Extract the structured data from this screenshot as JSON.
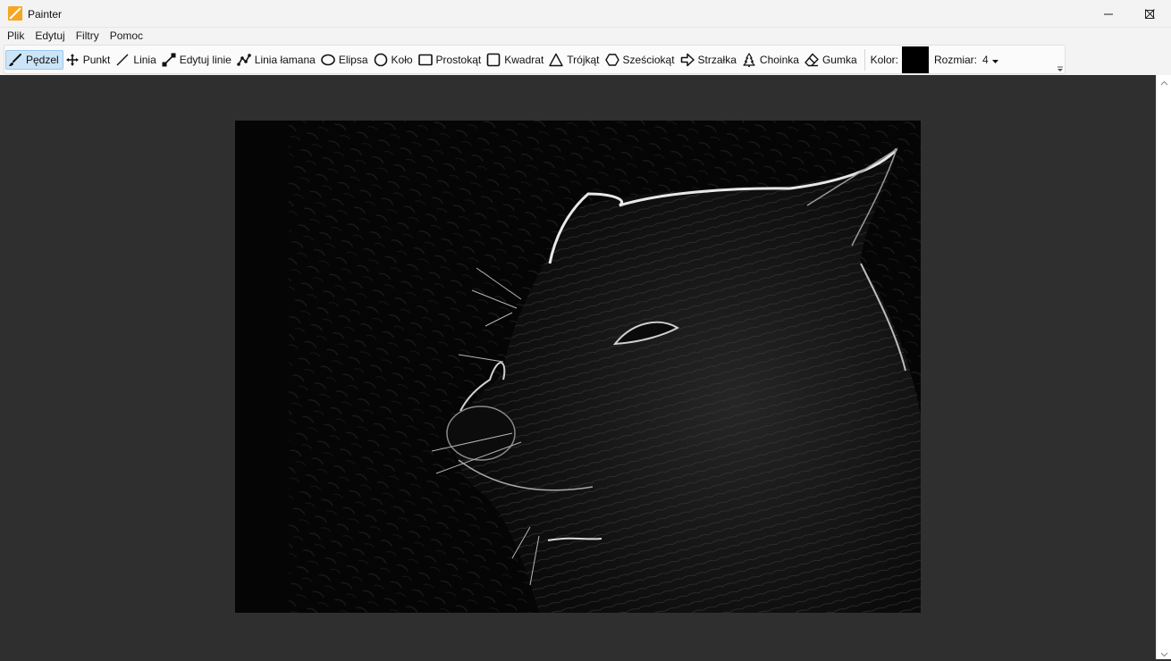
{
  "window": {
    "title": "Painter",
    "controls": {
      "minimize": "minimize",
      "maximize": "maximize",
      "close": "close"
    }
  },
  "menu": [
    "Plik",
    "Edytuj",
    "Filtry",
    "Pomoc"
  ],
  "toolbar": {
    "tools": [
      {
        "label": "Pędzel",
        "icon": "brush-icon",
        "active": true
      },
      {
        "label": "Punkt",
        "icon": "move-point-icon"
      },
      {
        "label": "Linia",
        "icon": "line-icon"
      },
      {
        "label": "Edytuj linie",
        "icon": "edit-line-icon"
      },
      {
        "label": "Linia łamana",
        "icon": "polyline-icon"
      },
      {
        "label": "Elipsa",
        "icon": "ellipse-icon"
      },
      {
        "label": "Koło",
        "icon": "circle-icon"
      },
      {
        "label": "Prostokąt",
        "icon": "rectangle-icon"
      },
      {
        "label": "Kwadrat",
        "icon": "square-icon"
      },
      {
        "label": "Trójkąt",
        "icon": "triangle-icon"
      },
      {
        "label": "Sześciokąt",
        "icon": "hexagon-icon"
      },
      {
        "label": "Strzałka",
        "icon": "arrow-icon"
      },
      {
        "label": "Choinka",
        "icon": "tree-icon"
      },
      {
        "label": "Gumka",
        "icon": "eraser-icon"
      }
    ],
    "color_label": "Kolor:",
    "color_value": "#000000",
    "size_label": "Rozmiar:",
    "size_value": "4"
  },
  "colors": {
    "workspace": "#2f2f2f",
    "chrome": "#f3f3f3",
    "active_tool": "#cce4f7",
    "app_icon": "#f5a623"
  }
}
